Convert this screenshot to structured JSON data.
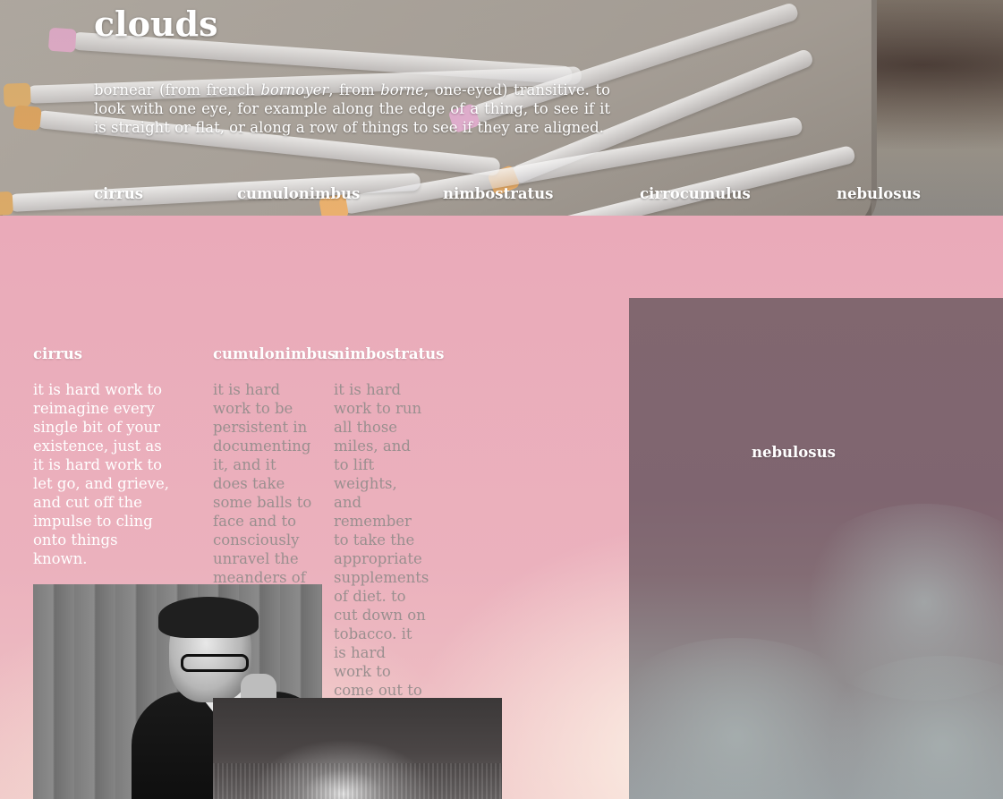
{
  "site": {
    "title": "clouds",
    "definition_parts": {
      "p1": "bornear (from french ",
      "i1": "bornoyer",
      "p2": ", from ",
      "i2": "borne",
      "p3": ", one-eyed) transitive. to look with one eye, for example along the edge of a thing, to see if it is straight or flat, or along a row of things to see if they are aligned."
    }
  },
  "nav": {
    "cirrus": "cirrus",
    "cumulonimbus": "cumulonimbus",
    "nimbostratus": "nimbostratus",
    "cirrocumulus": "cirrocumulus",
    "nebulosus": "nebulosus"
  },
  "sections": {
    "cirrus": {
      "heading": "cirrus",
      "body": "it is hard work to reimagine every single bit of your existence, just as it is hard work to let go, and grieve, and cut off the impulse to cling onto things known."
    },
    "cumulonimbus": {
      "heading": "cumulonimbus",
      "body": "it is hard work to be persistent in documenting it, and it does take some balls to face and to consciously unravel the meanders of the process."
    },
    "nimbostratus": {
      "heading": "nimbostratus",
      "body": "it is hard work to run all those miles, and to lift weights, and remember to take the appropriate supplements of diet. to cut down on tobacco. it is hard work to come out to friend"
    },
    "nebulosus": {
      "heading": "nebulosus"
    }
  }
}
